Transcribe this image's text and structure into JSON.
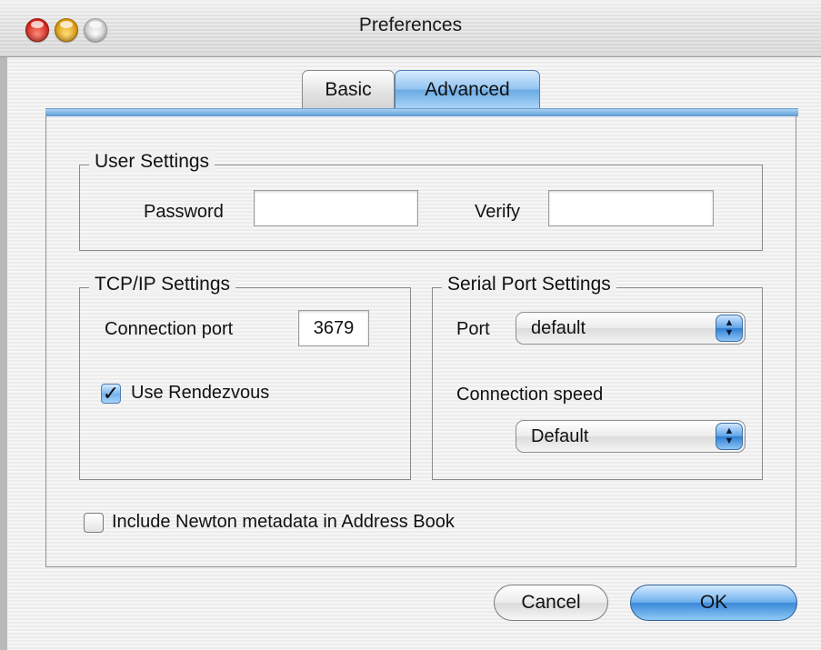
{
  "window": {
    "title": "Preferences"
  },
  "tabs": [
    {
      "label": "Basic",
      "selected": false
    },
    {
      "label": "Advanced",
      "selected": true
    }
  ],
  "user_settings": {
    "legend": "User Settings",
    "password_label": "Password",
    "password_value": "",
    "verify_label": "Verify",
    "verify_value": ""
  },
  "tcpip": {
    "legend": "TCP/IP Settings",
    "port_label": "Connection port",
    "port_value": "3679",
    "rendezvous_label": "Use Rendezvous",
    "rendezvous_checked": true
  },
  "serial": {
    "legend": "Serial Port Settings",
    "port_label": "Port",
    "port_value": "default",
    "speed_label": "Connection speed",
    "speed_value": "Default"
  },
  "metadata": {
    "label": "Include Newton metadata in Address Book",
    "checked": false
  },
  "buttons": {
    "cancel": "Cancel",
    "ok": "OK"
  },
  "colors": {
    "accent": "#6aaae4",
    "default_button": "#3b8ad9"
  }
}
